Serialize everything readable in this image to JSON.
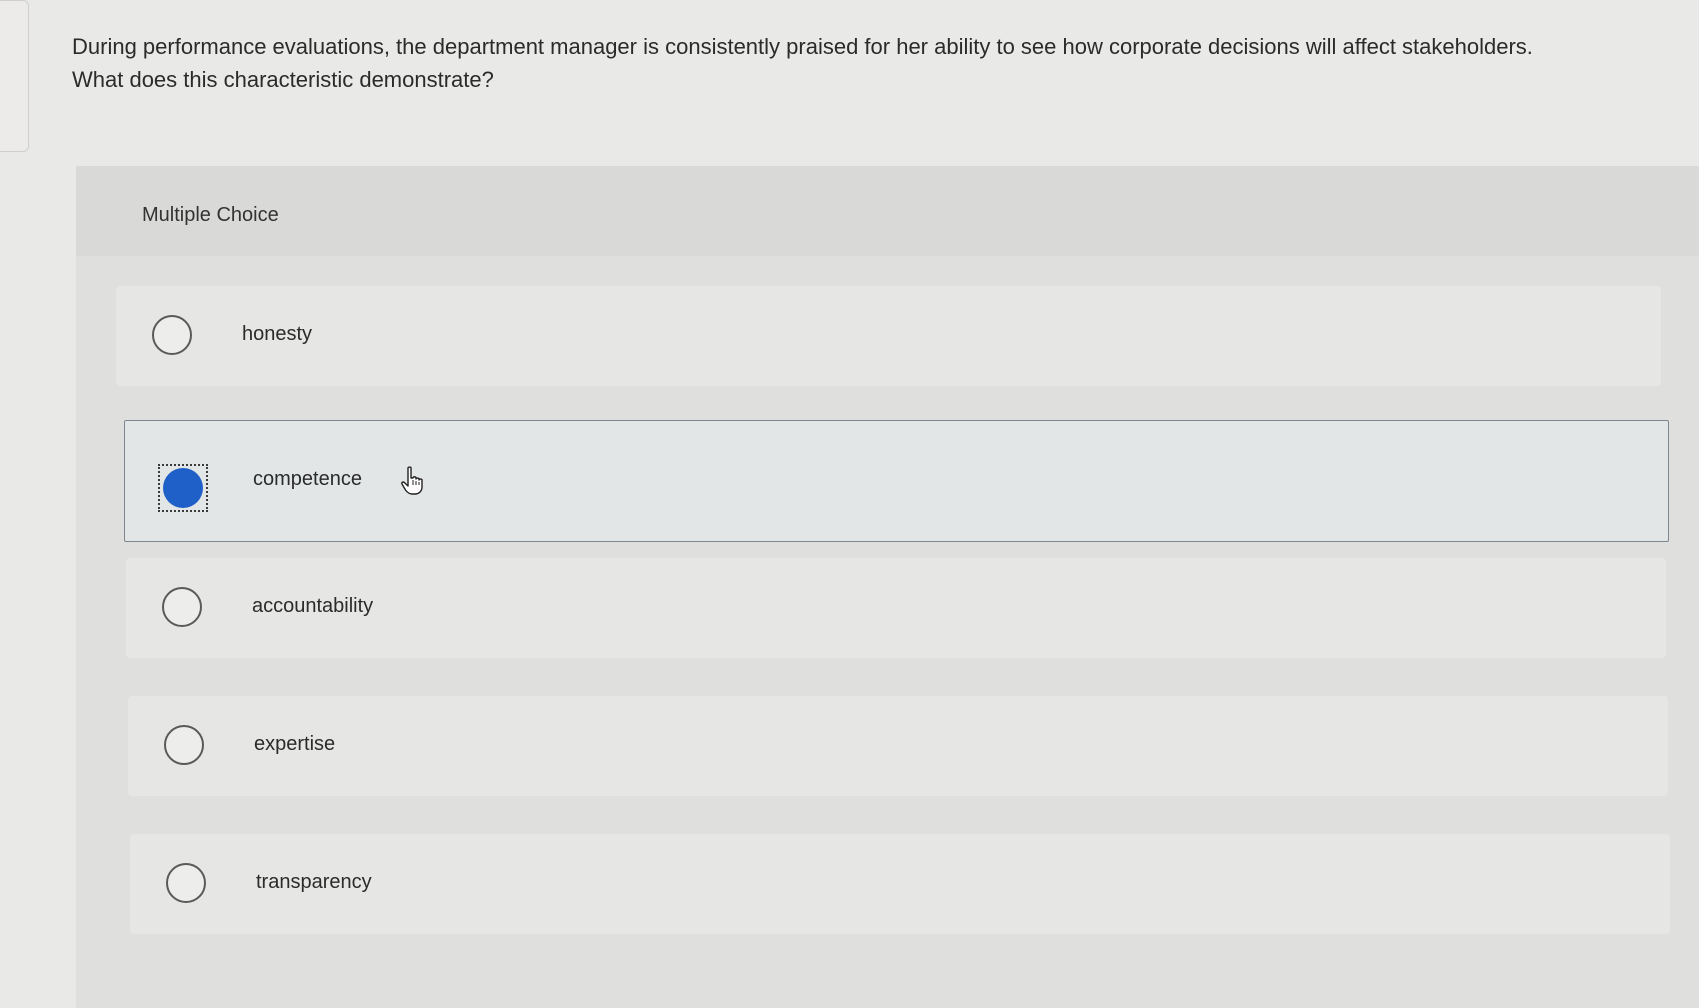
{
  "question": {
    "line1": "During performance evaluations, the department manager is consistently praised for her ability to see how corporate decisions will affect stakeholders.",
    "line2": "What does this characteristic demonstrate?"
  },
  "mc": {
    "label": "Multiple Choice",
    "options": [
      {
        "label": "honesty",
        "selected": false
      },
      {
        "label": "competence",
        "selected": true
      },
      {
        "label": "accountability",
        "selected": false
      },
      {
        "label": "expertise",
        "selected": false
      },
      {
        "label": "transparency",
        "selected": false
      }
    ]
  },
  "colors": {
    "selected_radio": "#1f5fc8",
    "selected_border": "#7c8790",
    "background": "#e9e9e7"
  },
  "icons": {
    "cursor": "hand-pointer-icon",
    "radio": "radio-circle-icon"
  }
}
